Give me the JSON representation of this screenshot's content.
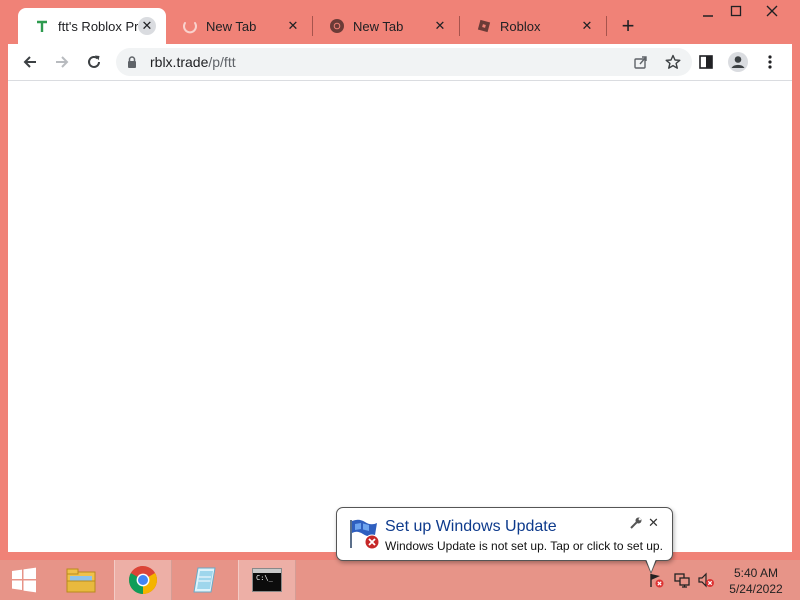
{
  "browser": {
    "tabs": [
      {
        "title": "ftt's Roblox Prof",
        "favicon": "trade-t-icon",
        "active": true
      },
      {
        "title": "New Tab",
        "favicon": "loading-spinner-icon",
        "active": false
      },
      {
        "title": "New Tab",
        "favicon": "chrome-icon",
        "active": false
      },
      {
        "title": "Roblox",
        "favicon": "roblox-icon",
        "active": false
      }
    ],
    "new_tab_label": "+",
    "address": {
      "host": "rblx.trade",
      "path": "/p/ftt"
    },
    "colors": {
      "frame": "#f08277",
      "tab_active": "#ffffff"
    }
  },
  "notification": {
    "title": "Set up Windows Update",
    "message": "Windows Update is not set up. Tap or click to set up.",
    "close_label": "✕"
  },
  "taskbar": {
    "apps": [
      {
        "name": "start-button"
      },
      {
        "name": "file-explorer"
      },
      {
        "name": "chrome"
      },
      {
        "name": "notepad"
      },
      {
        "name": "command-prompt"
      }
    ],
    "cmd_label": "C:\\_",
    "clock": {
      "time": "5:40 AM",
      "date": "5/24/2022"
    }
  }
}
